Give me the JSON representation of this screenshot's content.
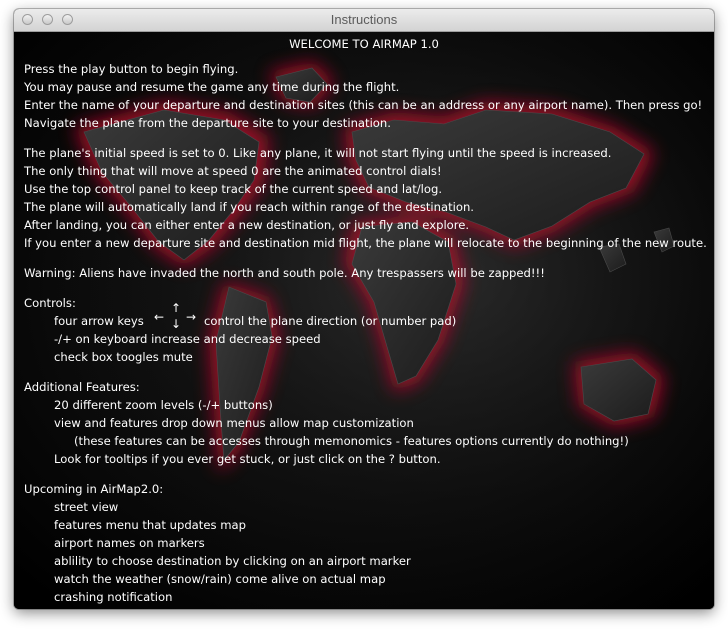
{
  "window": {
    "title": "Instructions"
  },
  "content": {
    "heading": "WELCOME TO AIRMAP 1.0",
    "intro": [
      "Press the play button to begin flying.",
      "You may pause and resume the game any time during the flight.",
      "Enter the name of your departure and destination sites (this can be an address or any airport name). Then press go!",
      "Navigate the plane from the departure site to your destination."
    ],
    "speed_notes": [
      "The plane's initial speed is set to 0. Like any plane, it will not start flying until the speed is increased.",
      "The only thing that will move at speed 0 are the animated control dials!",
      "Use the top control panel to keep track of the current speed and lat/log.",
      "The plane will automatically land if you reach within range of the destination.",
      "After landing, you can either enter a new destination, or just fly and explore.",
      "If you enter a new departure site and destination mid flight, the plane will relocate to the beginning of the new route."
    ],
    "warning": "Warning: Aliens have invaded the north and south pole. Any trespassers will be zapped!!!",
    "controls": {
      "heading": "Controls:",
      "arrow_keys_prefix": "four arrow keys",
      "arrow_keys_suffix": "control the plane direction (or number pad)",
      "arrow_glyphs": {
        "left": "←",
        "up": "↑",
        "down": "↓",
        "right": "→"
      },
      "speed_keys": "-/+ on keyboard increase and decrease speed",
      "mute": "check box toogles mute"
    },
    "additional_features": {
      "heading": "Additional Features:",
      "zoom": "20 different zoom levels (-/+ buttons)",
      "menus": "view and features drop down menus allow map customization",
      "menus_note": "(these features can be accesses through memonomics - features options currently do nothing!)",
      "tooltips": "Look for tooltips if you ever get stuck, or just click on the ? button."
    },
    "upcoming": {
      "heading": "Upcoming in AirMap2.0:",
      "items": [
        "street view",
        "features menu that updates map",
        "airport names on markers",
        "ablility to choose destination by clicking on an airport marker",
        "watch the weather (snow/rain) come alive on actual map",
        "crashing notification"
      ]
    }
  },
  "colors": {
    "background": "#060606",
    "map_land": "#2a2a2a",
    "map_glow": "#b0102a",
    "text": "#ffffff"
  }
}
